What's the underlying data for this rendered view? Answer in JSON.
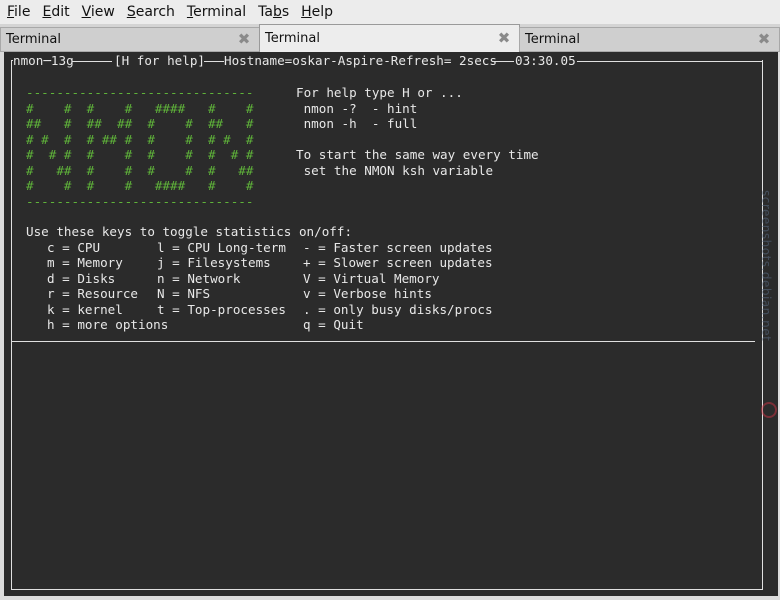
{
  "menubar": {
    "items": [
      {
        "label_ul": "F",
        "label_rest": "ile"
      },
      {
        "label_ul": "E",
        "label_rest": "dit"
      },
      {
        "label_ul": "V",
        "label_rest": "iew"
      },
      {
        "label_ul": "S",
        "label_rest": "earch"
      },
      {
        "label_ul": "T",
        "label_rest": "erminal"
      },
      {
        "label_pre": "Ta",
        "label_ul": "b",
        "label_rest": "s"
      },
      {
        "label_ul": "H",
        "label_rest": "elp"
      }
    ]
  },
  "tabs": [
    {
      "label": "Terminal",
      "close": "✖"
    },
    {
      "label": "Terminal",
      "close": "✖"
    },
    {
      "label": "Terminal",
      "close": "✖"
    }
  ],
  "terminal": {
    "header_left": "nmon─13g",
    "header_help": "[H for help]",
    "header_host": "Hostname=oskar-Aspire-Refresh= 2secs",
    "header_time": "03:30.05",
    "logo_lines": [
      "------------------------------",
      "#    #  #    #   ####   #    #",
      "##   #  ##  ##  #    #  ##   #",
      "# #  #  # ## #  #    #  # #  #",
      "#  # #  #    #  #    #  #  # #",
      "#   ##  #    #  #    #  #   ##",
      "#    #  #    #   ####   #    #",
      "------------------------------"
    ],
    "help_lines": [
      "For help type H or ...",
      " nmon -?  - hint",
      " nmon -h  - full",
      "",
      "To start the same way every time",
      " set the NMON ksh variable"
    ],
    "keys_title": "Use these keys to toggle statistics on/off:",
    "key_rows": [
      {
        "c1": "c = CPU",
        "c2": "l = CPU Long-term",
        "c3": "- = Faster screen updates"
      },
      {
        "c1": "m = Memory",
        "c2": "j = Filesystems",
        "c3": "+ = Slower screen updates"
      },
      {
        "c1": "d = Disks",
        "c2": "n = Network",
        "c3": "V = Virtual Memory"
      },
      {
        "c1": "r = Resource",
        "c2": "N = NFS",
        "c3": "v = Verbose hints"
      },
      {
        "c1": "k = kernel",
        "c2": "t = Top-processes",
        "c3": ". = only busy disks/procs"
      },
      {
        "c1": "h = more options",
        "c2": "",
        "c3": "q = Quit"
      }
    ]
  },
  "watermark": "screenshots.debian.net"
}
